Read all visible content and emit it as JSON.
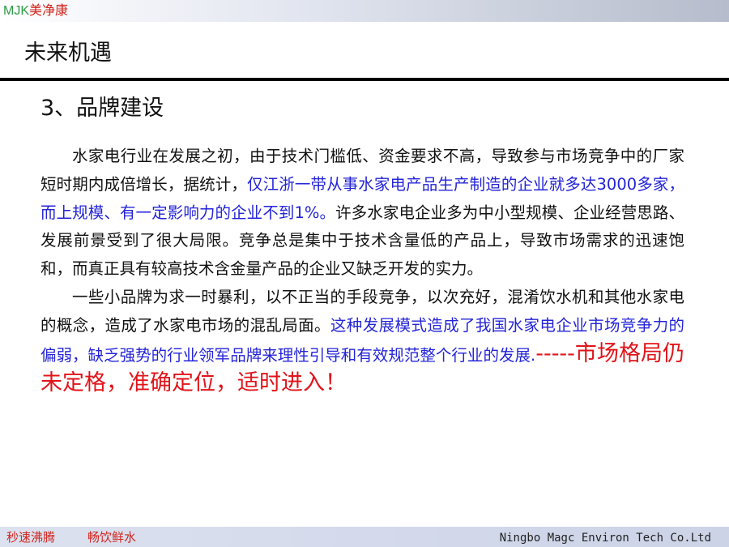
{
  "header": {
    "brand_latin": "MJK",
    "brand_cjk": "美净康"
  },
  "slide": {
    "title": "未来机遇",
    "section_heading": "3、品牌建设"
  },
  "content": {
    "para1": {
      "plain_1": "水家电行业在发展之初，由于技术门槛低、资金要求不高，导致参与市场竞争中的厂家短时期内成倍增长，据统计，",
      "highlight": "仅江浙一带从事水家电产品生产制造的企业就多达3000多家，而上规模、有一定影响力的企业不到1%。",
      "plain_2": "许多水家电企业多为中小型规模、企业经营思路、发展前景受到了很大局限。竞争总是集中于技术含量低的产品上，导致市场需求的迅速饱和，而真正具有较高技术含金量产品的企业又缺乏开发的实力。"
    },
    "para2": {
      "plain": "一些小品牌为求一时暴利，以不正当的手段竞争，以次充好，混淆饮水机和其他水家电的概念，造成了水家电市场的混乱局面。",
      "highlight_blue": "这种发展模式造成了我国水家电企业市场竞争力的偏弱，缺乏强势的行业领军品牌来理性引导和有效规范整个行业的发展.",
      "highlight_red": "-----市场格局仍未定格，准确定位，适时进入！"
    }
  },
  "footer": {
    "slogan_1": "秒速沸腾",
    "slogan_2": "畅饮鲜水",
    "company": "Ningbo Magc Environ Tech Co.Ltd"
  },
  "colors": {
    "brand_green": "#2e9b46",
    "brand_red": "#d2261f",
    "highlight_blue": "#2424d8",
    "highlight_red": "#e0141a"
  }
}
